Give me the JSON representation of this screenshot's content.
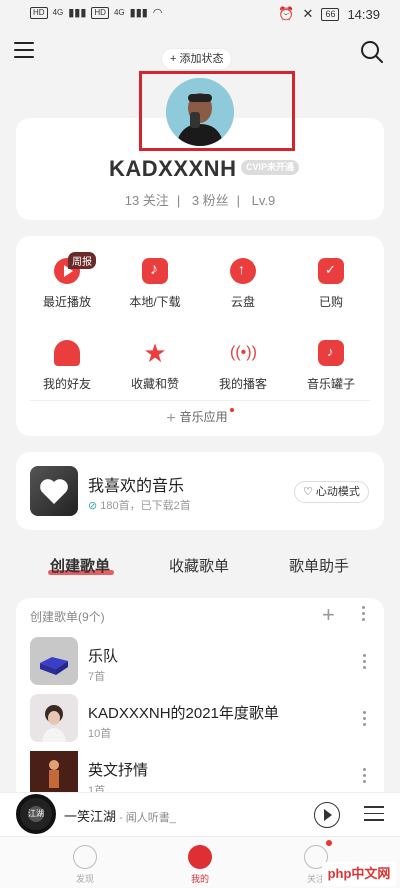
{
  "status_bar": {
    "sim1": "HD",
    "sim2": "HD",
    "signal1": "4G",
    "signal2": "4G",
    "battery": "66",
    "time": "14:39"
  },
  "header": {
    "add_status": "添加状态"
  },
  "profile": {
    "username": "KADXXXNH",
    "vip_label": "CVIP未开通",
    "follows": "13 关注",
    "fans": "3 粉丝",
    "level": "Lv.9"
  },
  "grid": {
    "weekly_badge": "周报",
    "items": [
      {
        "label": "最近播放",
        "icon": "play-circle-icon"
      },
      {
        "label": "本地/下载",
        "icon": "music-note-icon"
      },
      {
        "label": "云盘",
        "icon": "cloud-upload-icon"
      },
      {
        "label": "已购",
        "icon": "shopping-bag-icon"
      },
      {
        "label": "我的好友",
        "icon": "friends-icon"
      },
      {
        "label": "收藏和赞",
        "icon": "star-icon"
      },
      {
        "label": "我的播客",
        "icon": "radio-icon"
      },
      {
        "label": "音乐罐子",
        "icon": "jar-icon"
      }
    ],
    "music_apps": "音乐应用"
  },
  "liked": {
    "title": "我喜欢的音乐",
    "subtitle": "180首，已下载2首",
    "heartbeat": "心动模式"
  },
  "tabs": [
    {
      "label": "创建歌单"
    },
    {
      "label": "收藏歌单"
    },
    {
      "label": "歌单助手"
    }
  ],
  "playlists": {
    "header": "创建歌单(9个)",
    "items": [
      {
        "name": "乐队",
        "count": "7首",
        "color": "#c8c8c8"
      },
      {
        "name": "KADXXXNH的2021年度歌单",
        "count": "10首",
        "color": "#e9e4e6"
      },
      {
        "name": "英文抒情",
        "count": "1首",
        "color": "#5b2a1e"
      }
    ]
  },
  "mini_player": {
    "disc_text": "江湖",
    "title": "一笑江湖",
    "artist": " - 闻人听書_"
  },
  "nav": [
    {
      "label": "发现"
    },
    {
      "label": "我的"
    },
    {
      "label": "关注"
    }
  ],
  "watermark": "php中文网",
  "colors": {
    "accent": "#e02e35",
    "highlight_box": "#d6242f"
  }
}
